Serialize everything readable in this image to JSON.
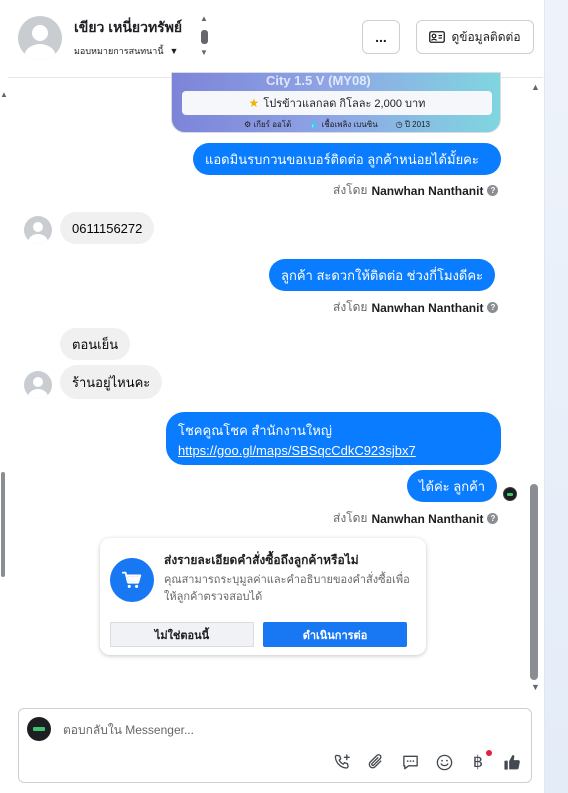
{
  "header": {
    "contact_name": "เขียว เหนี่ยวทรัพย์",
    "assign_label": "มอบหมายการสนทนานี้",
    "more_label": "...",
    "contact_info_label": "ดูข้อมูลติดต่อ"
  },
  "product_card": {
    "title": "City 1.5 V (MY08)",
    "promo": "โปรข้าวแลกลด กิโลละ 2,000 บาท",
    "specs": [
      "เกียร์ ออโต้",
      "เชื้อเพลิง เบนซิน",
      "ปี 2013"
    ]
  },
  "messages": {
    "m1": "แอดมินรบกวนขอเบอร์ติดต่อ ลูกค้าหน่อยได้มั้ยคะ",
    "sent_by_prefix": "ส่งโดย",
    "agent_name": "Nanwhan Nanthanit",
    "m2": "0611156272",
    "m3": "ลูกค้า สะดวกให้ติดต่อ ช่วงกี่โมงดีคะ",
    "m4": "ตอนเย็น",
    "m5": "ร้านอยู่ไหนคะ",
    "m6_line1": "โชคคูณโชค สำนักงานใหญ่",
    "m6_link": "https://goo.gl/maps/SBSqcCdkC923sjbx7",
    "m7": "ได้ค่ะ  ลูกค้า"
  },
  "order_prompt": {
    "title": "ส่งรายละเอียดคำสั่งซื้อถึงลูกค้าหรือไม่",
    "description": "คุณสามารถระบุมูลค่าและคำอธิบายของคำสั่งซื้อเพื่อให้ลูกค้าตรวจสอบได้",
    "decline_label": "ไม่ใช่ตอนนี้",
    "accept_label": "ดำเนินการต่อ"
  },
  "composer": {
    "placeholder": "ตอบกลับใน Messenger..."
  },
  "colors": {
    "outgoing_bubble": "#0a7cff",
    "incoming_bubble": "#f0f0f0",
    "primary_button": "#1877f2",
    "notification_dot": "#e41e3f"
  },
  "icons": {
    "composer_tools": [
      "call-add-icon",
      "attachment-icon",
      "saved-reply-icon",
      "emoji-icon",
      "baht-payment-icon",
      "thumbs-up-icon"
    ]
  }
}
